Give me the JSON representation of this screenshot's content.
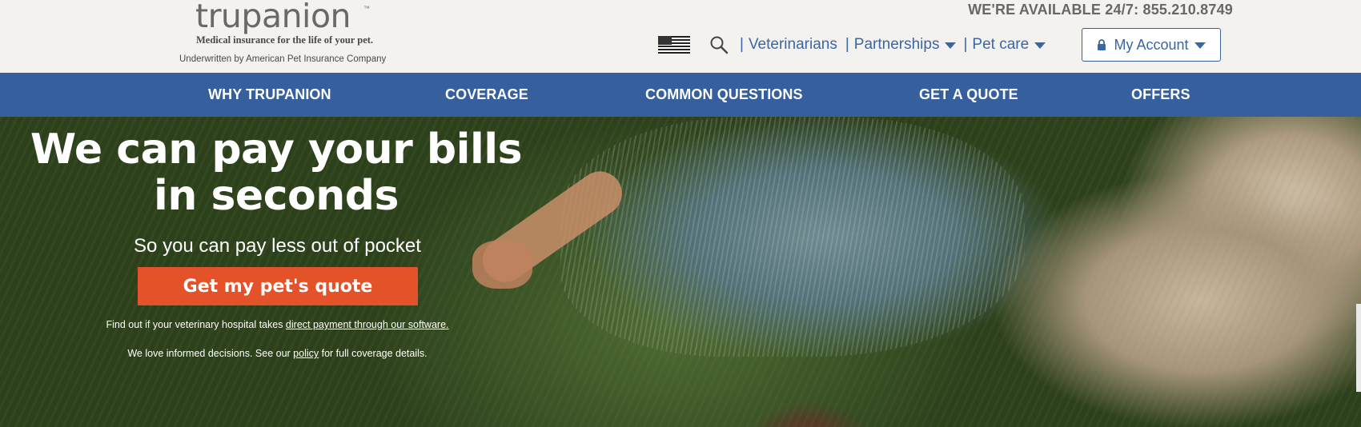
{
  "header": {
    "logo_text": "trupanion",
    "logo_tm": "™",
    "logo_tagline": "Medical insurance for the life of your pet.",
    "underwritten": "Underwritten by American Pet Insurance Company",
    "availability": "WE'RE AVAILABLE 24/7: 855.210.8749",
    "utility_links": {
      "veterinarians": "Veterinarians",
      "partnerships": "Partnerships",
      "pet_care": "Pet care"
    },
    "separator": "|",
    "account_label": "My Account",
    "icons": {
      "flag": "us-flag-icon",
      "search": "search-icon",
      "lock": "lock-icon",
      "caret": "caret-down-icon"
    }
  },
  "nav": {
    "items": [
      "WHY TRUPANION",
      "COVERAGE",
      "COMMON QUESTIONS",
      "GET A QUOTE",
      "OFFERS"
    ]
  },
  "hero": {
    "title": "We can pay your bills in seconds",
    "subtitle": "So you can pay less out of pocket",
    "cta_label": "Get my pet's quote",
    "note1_prefix": "Find out if your veterinary hospital takes ",
    "note1_link": "direct payment through our software.",
    "note2_prefix": "We love informed decisions. See our ",
    "note2_link": "policy",
    "note2_suffix": " for full coverage details."
  },
  "colors": {
    "nav_background": "#355f9d",
    "link_blue": "#3a66a5",
    "cta_orange": "#e4522a",
    "header_background": "#f4f2ef"
  }
}
